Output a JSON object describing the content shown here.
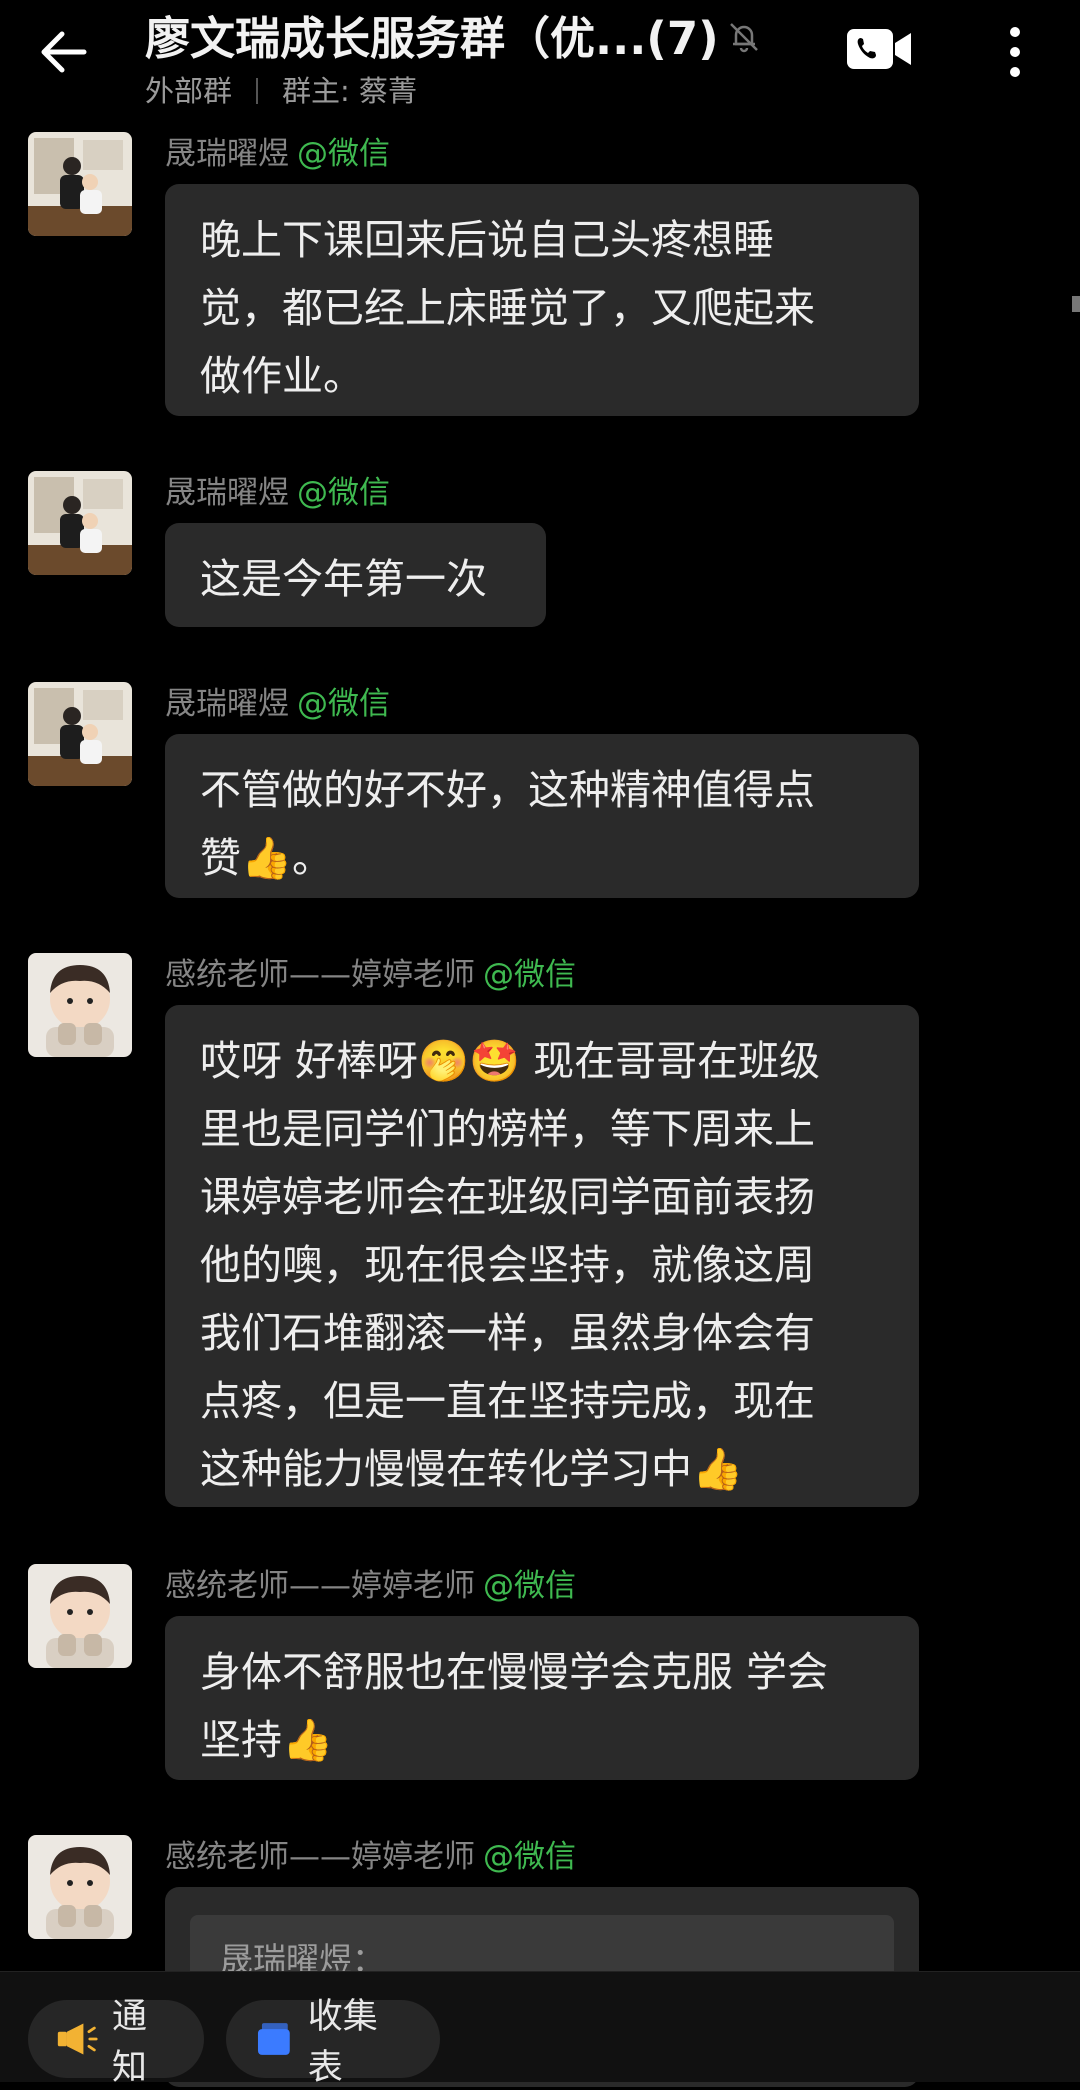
{
  "header": {
    "title": "廖文瑞成长服务群（优...(7)",
    "group_type": "外部群",
    "owner": "群主: 蔡菁"
  },
  "messages": [
    {
      "sender": "晟瑞曜煜",
      "source": "@微信",
      "avatar": "parent-photo",
      "text": "晚上下课回来后说自己头疼想睡\n觉，都已经上床睡觉了，又爬起来\n做作业。"
    },
    {
      "sender": "晟瑞曜煜",
      "source": "@微信",
      "avatar": "parent-photo",
      "text": "这是今年第一次"
    },
    {
      "sender": "晟瑞曜煜",
      "source": "@微信",
      "avatar": "parent-photo",
      "text": "不管做的好不好，这种精神值得点\n赞👍。"
    },
    {
      "sender": "感统老师——婷婷老师",
      "source": "@微信",
      "avatar": "baby-photo",
      "text": "哎呀 好棒呀🤭🤩 现在哥哥在班级\n里也是同学们的榜样，等下周来上\n课婷婷老师会在班级同学面前表扬\n他的噢，现在很会坚持，就像这周\n我们石堆翻滚一样，虽然身体会有\n点疼，但是一直在坚持完成，现在\n这种能力慢慢在转化学习中👍"
    },
    {
      "sender": "感统老师——婷婷老师",
      "source": "@微信",
      "avatar": "baby-photo",
      "text": "身体不舒服也在慢慢学会克服 学会\n坚持👍"
    },
    {
      "sender": "感统老师——婷婷老师",
      "source": "@微信",
      "avatar": "baby-photo",
      "quote": "晟瑞曜煜："
    }
  ],
  "bottom_bar": {
    "notice_label": "通知",
    "form_label": "收集表"
  },
  "colors": {
    "background": "#000000",
    "bubble": "#2a2a2a",
    "source_green": "#3fb950",
    "sender_gray": "#858585"
  },
  "icons": [
    "back-arrow-icon",
    "mute-bell-icon",
    "video-call-icon",
    "more-vertical-icon",
    "megaphone-icon",
    "form-stack-icon"
  ]
}
